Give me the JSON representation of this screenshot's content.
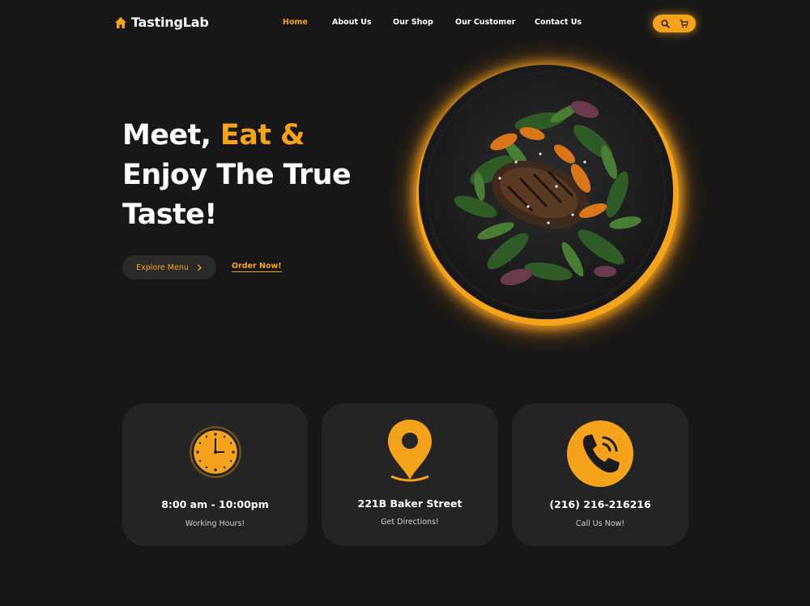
{
  "brand": {
    "name": "TastingLab",
    "icon": "home-icon",
    "accent_color": "#f5a21c"
  },
  "nav": {
    "items": [
      {
        "label": "Home",
        "active": true
      },
      {
        "label": "About Us",
        "active": false
      },
      {
        "label": "Our Shop",
        "active": false
      },
      {
        "label": "Our Customer",
        "active": false
      },
      {
        "label": "Contact Us",
        "active": false
      }
    ],
    "actions": {
      "search_icon": "search-icon",
      "cart_icon": "cart-icon"
    }
  },
  "hero": {
    "title_line1_white": "Meet, ",
    "title_line1_accent": "Eat &",
    "title_line2": "Enjoy The True",
    "title_line3": "Taste!",
    "explore_label": "Explore Menu",
    "explore_icon": "chevron-right-icon",
    "order_label": "Order Now!",
    "image": "plate-of-food"
  },
  "info_cards": [
    {
      "icon": "clock-icon",
      "title": "8:00 am - 10:00pm",
      "subtitle": "Working Hours!"
    },
    {
      "icon": "location-pin-icon",
      "title": "221B Baker Street",
      "subtitle": "Get Directions!"
    },
    {
      "icon": "phone-icon",
      "title": "(216) 216-216216",
      "subtitle": "Call Us Now!"
    }
  ]
}
